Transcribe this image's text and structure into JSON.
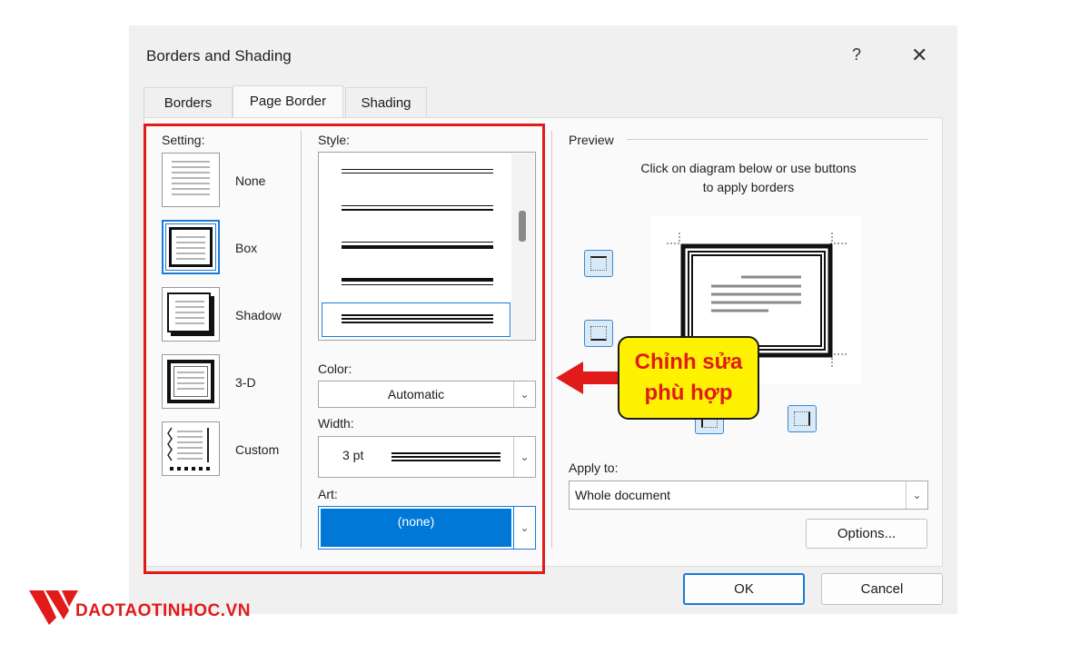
{
  "dialog": {
    "title": "Borders and Shading",
    "help_glyph": "?",
    "close_glyph": "✕"
  },
  "tabs": [
    {
      "label": "Borders"
    },
    {
      "label": "Page Border"
    },
    {
      "label": "Shading"
    }
  ],
  "setting": {
    "label": "Setting:",
    "items": [
      {
        "label": "None"
      },
      {
        "label": "Box"
      },
      {
        "label": "Shadow"
      },
      {
        "label": "3-D"
      },
      {
        "label": "Custom"
      }
    ],
    "selected": "Box"
  },
  "style": {
    "label": "Style:"
  },
  "color": {
    "label": "Color:",
    "value": "Automatic"
  },
  "width": {
    "label": "Width:",
    "value": "3 pt"
  },
  "art": {
    "label": "Art:",
    "value": "(none)"
  },
  "preview": {
    "label": "Preview",
    "instruction_line1": "Click on diagram below or use buttons",
    "instruction_line2": "to apply borders"
  },
  "apply_to": {
    "label": "Apply to:",
    "value": "Whole document"
  },
  "buttons": {
    "options": "Options...",
    "ok": "OK",
    "cancel": "Cancel"
  },
  "annotation": {
    "line1": "Chỉnh sửa",
    "line2": "phù hợp"
  },
  "watermark": {
    "text": "DAOTAOTINHOC.VN"
  },
  "colors": {
    "accent": "#1a7ad6",
    "highlight": "#e11a1a",
    "callout_bg": "#fff200",
    "selection_fill": "#0078d7"
  }
}
